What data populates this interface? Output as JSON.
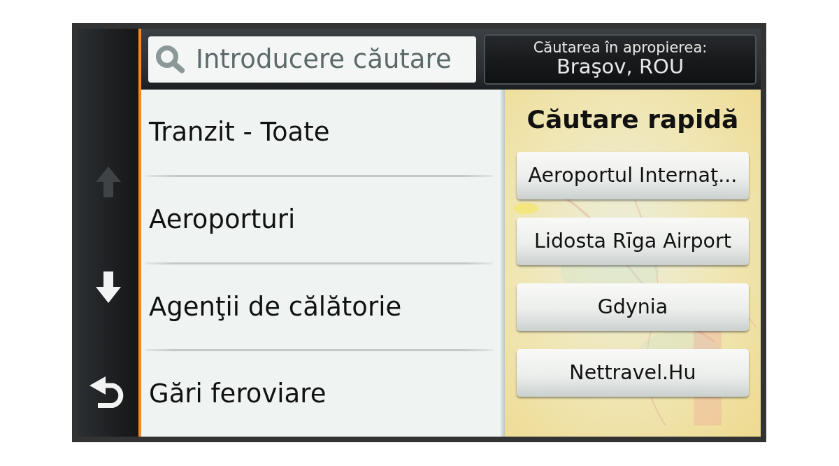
{
  "nav_buttons": [
    {
      "kind": "up",
      "disabled": true
    },
    {
      "kind": "down",
      "disabled": false
    },
    {
      "kind": "back",
      "disabled": false
    }
  ],
  "search": {
    "placeholder": "Introducere căutare"
  },
  "search_near": {
    "label": "Căutarea în apropierea:",
    "location": "Braşov, ROU"
  },
  "categories": [
    "Tranzit - Toate",
    "Aeroporturi",
    "Agenţii de călătorie",
    "Gări feroviare"
  ],
  "quick_search": {
    "title": "Căutare rapidă",
    "results": [
      "Aeroportul Internaţ...",
      "Lidosta Rīga Airport",
      "Gdynia",
      "Nettravel.Hu"
    ]
  }
}
